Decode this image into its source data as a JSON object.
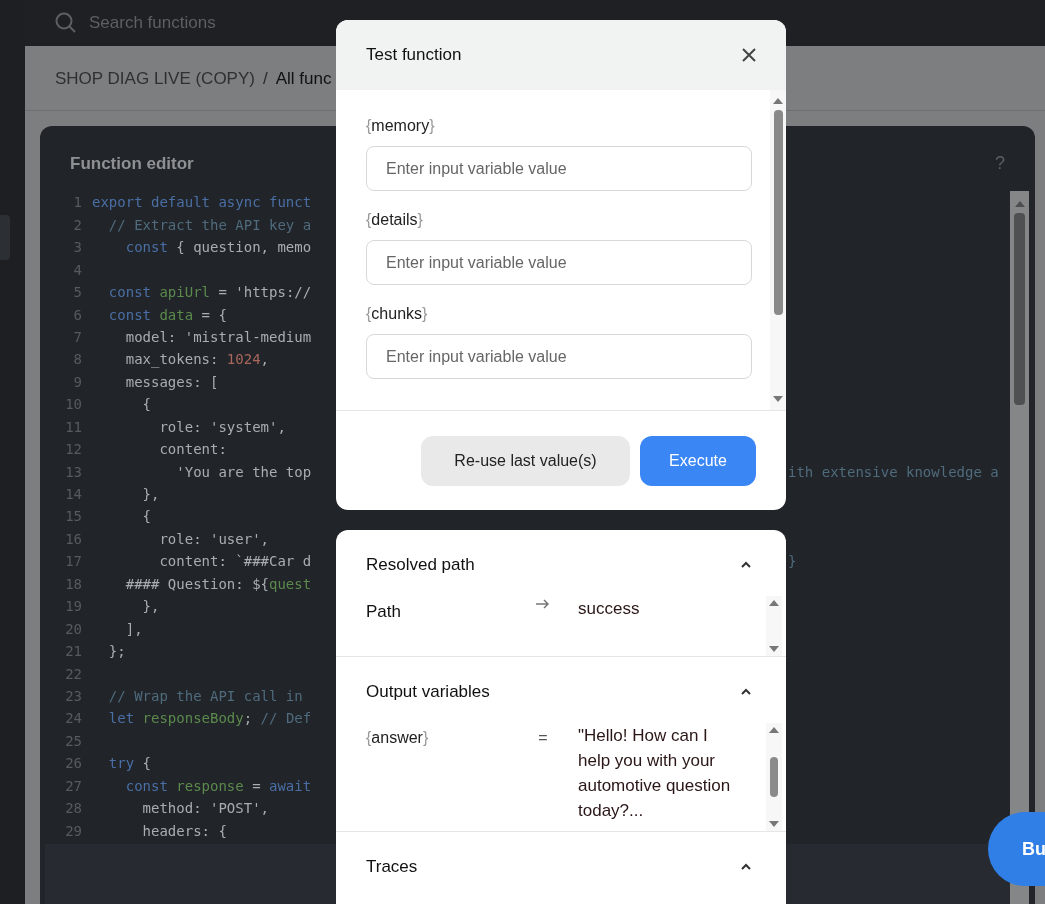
{
  "search": {
    "placeholder": "Search functions"
  },
  "breadcrumb": [
    {
      "label": "SHOP DIAG LIVE (COPY)",
      "selected": false
    },
    {
      "label": "All func",
      "selected": true
    }
  ],
  "breadcrumb_separator": "/",
  "editor": {
    "title": "Function editor",
    "help": "?",
    "lines": [
      {
        "n": "1",
        "tokens": [
          {
            "kind": "keyword",
            "text": "export default async funct"
          }
        ]
      },
      {
        "n": "2",
        "tokens": [
          {
            "kind": "comment",
            "text": "  // Extract the API key a"
          }
        ]
      },
      {
        "n": "3",
        "tokens": [
          {
            "kind": "keyword",
            "text": "    const"
          },
          {
            "kind": "plain",
            "text": " { question, memo"
          }
        ]
      },
      {
        "n": "4"
      },
      {
        "n": "5",
        "tokens": [
          {
            "kind": "keyword",
            "text": "  const"
          },
          {
            "kind": "variable",
            "text": " apiUrl"
          },
          {
            "kind": "plain",
            "text": " = 'https://"
          }
        ]
      },
      {
        "n": "6",
        "tokens": [
          {
            "kind": "keyword",
            "text": "  const"
          },
          {
            "kind": "variable",
            "text": " data"
          },
          {
            "kind": "plain",
            "text": " = {"
          }
        ]
      },
      {
        "n": "7",
        "tokens": [
          {
            "kind": "plain",
            "text": "    model: 'mistral-medium"
          }
        ]
      },
      {
        "n": "8",
        "tokens": [
          {
            "kind": "plain",
            "text": "    max_tokens: "
          },
          {
            "kind": "number",
            "text": "1024"
          },
          {
            "kind": "plain",
            "text": ","
          }
        ]
      },
      {
        "n": "9",
        "tokens": [
          {
            "kind": "plain",
            "text": "    messages: ["
          }
        ]
      },
      {
        "n": "10",
        "tokens": [
          {
            "kind": "plain",
            "text": "      {"
          }
        ]
      },
      {
        "n": "11",
        "tokens": [
          {
            "kind": "plain",
            "text": "        role: 'system',"
          }
        ]
      },
      {
        "n": "12",
        "tokens": [
          {
            "kind": "plain",
            "text": "        content:"
          }
        ]
      },
      {
        "n": "13",
        "tokens": [
          {
            "kind": "plain",
            "text": "          'You are the top"
          }
        ],
        "right": [
          {
            "kind": "comment",
            "text": "ith extensive knowledge a"
          }
        ]
      },
      {
        "n": "14",
        "tokens": [
          {
            "kind": "plain",
            "text": "      },"
          }
        ]
      },
      {
        "n": "15",
        "tokens": [
          {
            "kind": "plain",
            "text": "      {"
          }
        ]
      },
      {
        "n": "16",
        "tokens": [
          {
            "kind": "plain",
            "text": "        role: 'user',"
          }
        ]
      },
      {
        "n": "17",
        "tokens": [
          {
            "kind": "plain",
            "text": "        content: `###Car d"
          }
        ],
        "right": [
          {
            "kind": "comment",
            "text": "}"
          }
        ]
      },
      {
        "n": "18",
        "tokens": [
          {
            "kind": "plain",
            "text": "    #### Question: ${"
          },
          {
            "kind": "variable",
            "text": "quest"
          }
        ]
      },
      {
        "n": "19",
        "tokens": [
          {
            "kind": "plain",
            "text": "      },"
          }
        ]
      },
      {
        "n": "20",
        "tokens": [
          {
            "kind": "plain",
            "text": "    ],"
          }
        ]
      },
      {
        "n": "21",
        "tokens": [
          {
            "kind": "plain",
            "text": "  };"
          }
        ]
      },
      {
        "n": "22"
      },
      {
        "n": "23",
        "tokens": [
          {
            "kind": "comment",
            "text": "  // Wrap the API call in"
          }
        ]
      },
      {
        "n": "24",
        "tokens": [
          {
            "kind": "keyword",
            "text": "  let"
          },
          {
            "kind": "variable",
            "text": " responseBody"
          },
          {
            "kind": "plain",
            "text": ";"
          },
          {
            "kind": "comment",
            "text": " // Def"
          }
        ]
      },
      {
        "n": "25"
      },
      {
        "n": "26",
        "tokens": [
          {
            "kind": "keyword",
            "text": "  try"
          },
          {
            "kind": "plain",
            "text": " {"
          }
        ]
      },
      {
        "n": "27",
        "tokens": [
          {
            "kind": "keyword",
            "text": "    const"
          },
          {
            "kind": "variable",
            "text": " response"
          },
          {
            "kind": "plain",
            "text": " = "
          },
          {
            "kind": "keyword",
            "text": "await"
          }
        ]
      },
      {
        "n": "28",
        "tokens": [
          {
            "kind": "plain",
            "text": "      method: 'POST',"
          }
        ]
      },
      {
        "n": "29",
        "tokens": [
          {
            "kind": "plain",
            "text": "      headers: {"
          }
        ]
      }
    ]
  },
  "corner_button": {
    "label": "Bu"
  },
  "test_dialog": {
    "title": "Test function",
    "inputs": [
      {
        "name": "{memory}",
        "placeholder": "Enter input variable value"
      },
      {
        "name": "{details}",
        "placeholder": "Enter input variable value"
      },
      {
        "name": "{chunks}",
        "placeholder": "Enter input variable value"
      }
    ],
    "buttons": [
      {
        "label": "Re-use last value(s)",
        "kind": "secondary"
      },
      {
        "label": "Execute",
        "kind": "primary"
      }
    ]
  },
  "results": [
    {
      "title": "Resolved path",
      "expanded": true,
      "rows": [
        {
          "name": "Path",
          "kind": "arrow",
          "value": "success"
        }
      ]
    },
    {
      "title": "Output variables",
      "expanded": true,
      "rows": [
        {
          "name": "{answer}",
          "kind": "variable",
          "sign": "=",
          "value": "\"Hello! How can I help you with your automotive question today?..."
        }
      ]
    },
    {
      "title": "Traces",
      "expanded": true
    }
  ]
}
